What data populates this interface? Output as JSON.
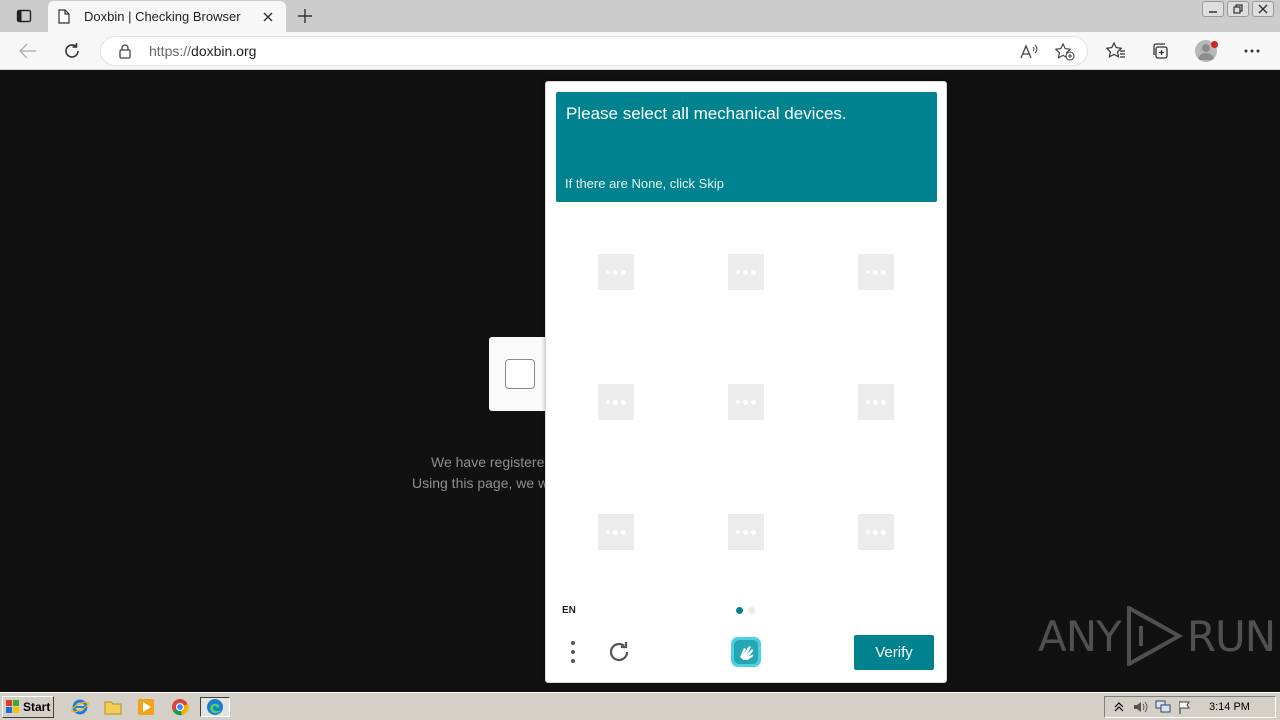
{
  "browser": {
    "tab": {
      "title": "Doxbin | Checking Browser"
    },
    "address": {
      "protocol": "https://",
      "domain": "doxbin.org"
    }
  },
  "page": {
    "background_text": [
      "We have registere",
      "Using this page, we w"
    ]
  },
  "captcha": {
    "prompt_title": "Please select all mechanical devices.",
    "prompt_subtitle": "If there are None, click Skip",
    "grid_cells": 9,
    "language": "EN",
    "pages": 2,
    "active_page": 1,
    "verify_label": "Verify",
    "accent_color": "#00838f"
  },
  "watermark": {
    "left": "ANY",
    "right": "RUN"
  },
  "taskbar": {
    "start_label": "Start",
    "clock": "3:14 PM"
  }
}
